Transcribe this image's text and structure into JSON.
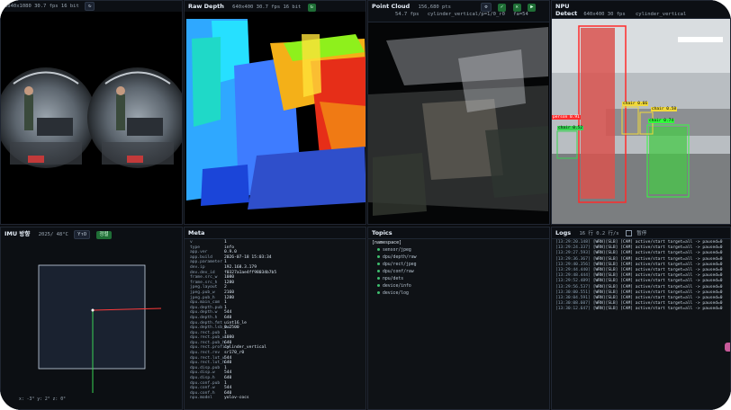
{
  "panels": {
    "camera": {
      "info": "3840x1080 30.7 fps 16 bit"
    },
    "raw_depth": {
      "title": "Raw Depth",
      "info": "640x400 30.7 fps 16 bit"
    },
    "point_cloud": {
      "title": "Point Cloud",
      "info_line1": "156,680 pts",
      "info_line2": "cylinder_vertical/p=1/0_r0",
      "sub": "54.7 fps",
      "fps": "fa=54"
    },
    "npu": {
      "title": "NPU Detect",
      "info": "640x400 30 fps",
      "model": "cylinder_vertical",
      "tags": [
        "person 0.91",
        "chair 0.74",
        "chair 0.66",
        "chair 0.58",
        "chair 0.52"
      ]
    },
    "imu": {
      "title": "IMU 방향",
      "stats": "2025/ 48°C",
      "btn_yo": "Y↑O",
      "btn_reset": "정렬",
      "axes": "x:  -3°   y:  2°   z:  0°"
    },
    "meta": {
      "title": "Meta",
      "rows": [
        [
          "v",
          "1"
        ],
        [
          "type",
          "info"
        ],
        [
          "app.ver",
          "0.9.0"
        ],
        [
          "app.build",
          "2026-07-18 15:03:34"
        ],
        [
          "app.parameter",
          "1"
        ],
        [
          "dev.ip",
          "192.168.3.179"
        ],
        [
          "dev.dev_id",
          "f0327a1ae4ff98034b7b5"
        ],
        [
          "frame.src_w",
          "1080"
        ],
        [
          "frame.src_h",
          "1280"
        ],
        [
          "jpeg.layout",
          "2"
        ],
        [
          "jpeg.pub_w",
          "2160"
        ],
        [
          "jpeg.pub_h",
          "1280"
        ],
        [
          "dpu.main_com",
          "1"
        ],
        [
          "dpu.depth.pub",
          "1"
        ],
        [
          "dpu.depth.w",
          "544"
        ],
        [
          "dpu.depth.h",
          "640"
        ],
        [
          "dpu.depth.fmt",
          "uint16_le"
        ],
        [
          "dpu.depth.lsb_mm",
          "0.2500"
        ],
        [
          "dpu.rect.pub",
          "1"
        ],
        [
          "dpu.rect.pub_w",
          "1080"
        ],
        [
          "dpu.rect.pub_h",
          "640"
        ],
        [
          "dpu.rect.profile",
          "cylinder_vertical"
        ],
        [
          "dpu.rect.rev",
          "sr170_r0"
        ],
        [
          "dpu.rect.lut_w",
          "544"
        ],
        [
          "dpu.rect.lut_h",
          "640"
        ],
        [
          "dpu.disp.pub",
          "1"
        ],
        [
          "dpu.disp.w",
          "544"
        ],
        [
          "dpu.disp.h",
          "640"
        ],
        [
          "dpu.conf.pub",
          "1"
        ],
        [
          "dpu.conf.w",
          "544"
        ],
        [
          "dpu.conf.h",
          "640"
        ],
        [
          "npu.model",
          "yolov-cocs"
        ]
      ]
    },
    "topics": {
      "title": "Topics",
      "namespace": "[namespace]",
      "items": [
        "sensor/jpeg",
        "dpu/depth/raw",
        "dpu/rect/jpeg",
        "dpu/conf/raw",
        "npu/dets",
        "device/info",
        "device/log"
      ]
    },
    "logs": {
      "title": "Logs",
      "stats": "16 行 0.2 行/s",
      "pause": "暂停",
      "lines": [
        [
          "[13:29:20.148]",
          "[WRN][SLB] [CAM] active/start target=all -> paused=0"
        ],
        [
          "[13:29:24.337]",
          "[WRN][SLB] [CAM] active/start target=all -> paused=0"
        ],
        [
          "[13:29:27.593]",
          "[WRN][SLB] [CAM] active/start target=all -> paused=0"
        ],
        [
          "[13:29:36.367]",
          "[WRN][SLB] [CAM] active/start target=all -> paused=0"
        ],
        [
          "[13:29:40.356]",
          "[WRN][SLB] [CAM] active/start target=all -> paused=0"
        ],
        [
          "[13:29:44.440]",
          "[WRN][SLB] [CAM] active/start target=all -> paused=0"
        ],
        [
          "[13:29:48.444]",
          "[WRN][SLB] [CAM] active/start target=all -> paused=0"
        ],
        [
          "[13:29:52.489]",
          "[WRN][SLB] [CAM] active/start target=all -> paused=0"
        ],
        [
          "[13:29:56.537]",
          "[WRN][SLB] [CAM] active/start target=all -> paused=0"
        ],
        [
          "[13:30:00.551]",
          "[WRN][SLB] [CAM] active/start target=all -> paused=0"
        ],
        [
          "[13:30:04.591]",
          "[WRN][SLB] [CAM] active/start target=all -> paused=0"
        ],
        [
          "[13:30:08.607]",
          "[WRN][SLB] [CAM] active/start target=all -> paused=0"
        ],
        [
          "[13:30:12.647]",
          "[WRN][SLB] [CAM] active/start target=all -> paused=0"
        ]
      ]
    }
  },
  "colors": {
    "accent_green": "#3fbf6f",
    "imu_box": "#c8d6e6",
    "imu_red": "#ff3b3b",
    "imu_green": "#39d353"
  }
}
